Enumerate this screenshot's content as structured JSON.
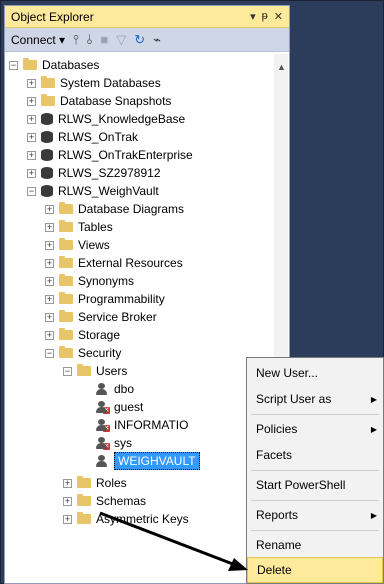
{
  "panel": {
    "title": "Object Explorer",
    "title_icons": [
      "pin-dropdown-icon",
      "pin-icon",
      "close-icon"
    ],
    "title_glyphs": [
      "▾",
      "ᵽ",
      "✕"
    ]
  },
  "toolbar": {
    "connect_label": "Connect ▾",
    "tools": [
      "connect-icon",
      "disconnect-icon",
      "stop-icon",
      "filter-icon",
      "refresh-icon",
      "activity-icon"
    ]
  },
  "tree": {
    "databases": "Databases",
    "system_databases": "System Databases",
    "database_snapshots": "Database Snapshots",
    "db1": "RLWS_KnowledgeBase",
    "db2": "RLWS_OnTrak",
    "db3": "RLWS_OnTrakEnterprise",
    "db4": "RLWS_SZ2978912",
    "db5": "RLWS_WeighVault",
    "database_diagrams": "Database Diagrams",
    "tables": "Tables",
    "views": "Views",
    "external_resources": "External Resources",
    "synonyms": "Synonyms",
    "programmability": "Programmability",
    "service_broker": "Service Broker",
    "storage": "Storage",
    "security": "Security",
    "users": "Users",
    "user_dbo": "dbo",
    "user_guest": "guest",
    "user_information": "INFORMATIO",
    "user_sys": "sys",
    "user_weighvault": "WEIGHVAULT",
    "roles": "Roles",
    "schemas": "Schemas",
    "asymmetric_keys": "Asymmetric Keys"
  },
  "context_menu": {
    "new_user": "New User...",
    "script_user_as": "Script User as",
    "policies": "Policies",
    "facets": "Facets",
    "start_powershell": "Start PowerShell",
    "reports": "Reports",
    "rename": "Rename",
    "delete": "Delete"
  },
  "colors": {
    "title_bar": "#ffe99a",
    "background": "#2b3d5b",
    "selection": "#3399ff",
    "menu_highlight": "#ffe99a"
  }
}
